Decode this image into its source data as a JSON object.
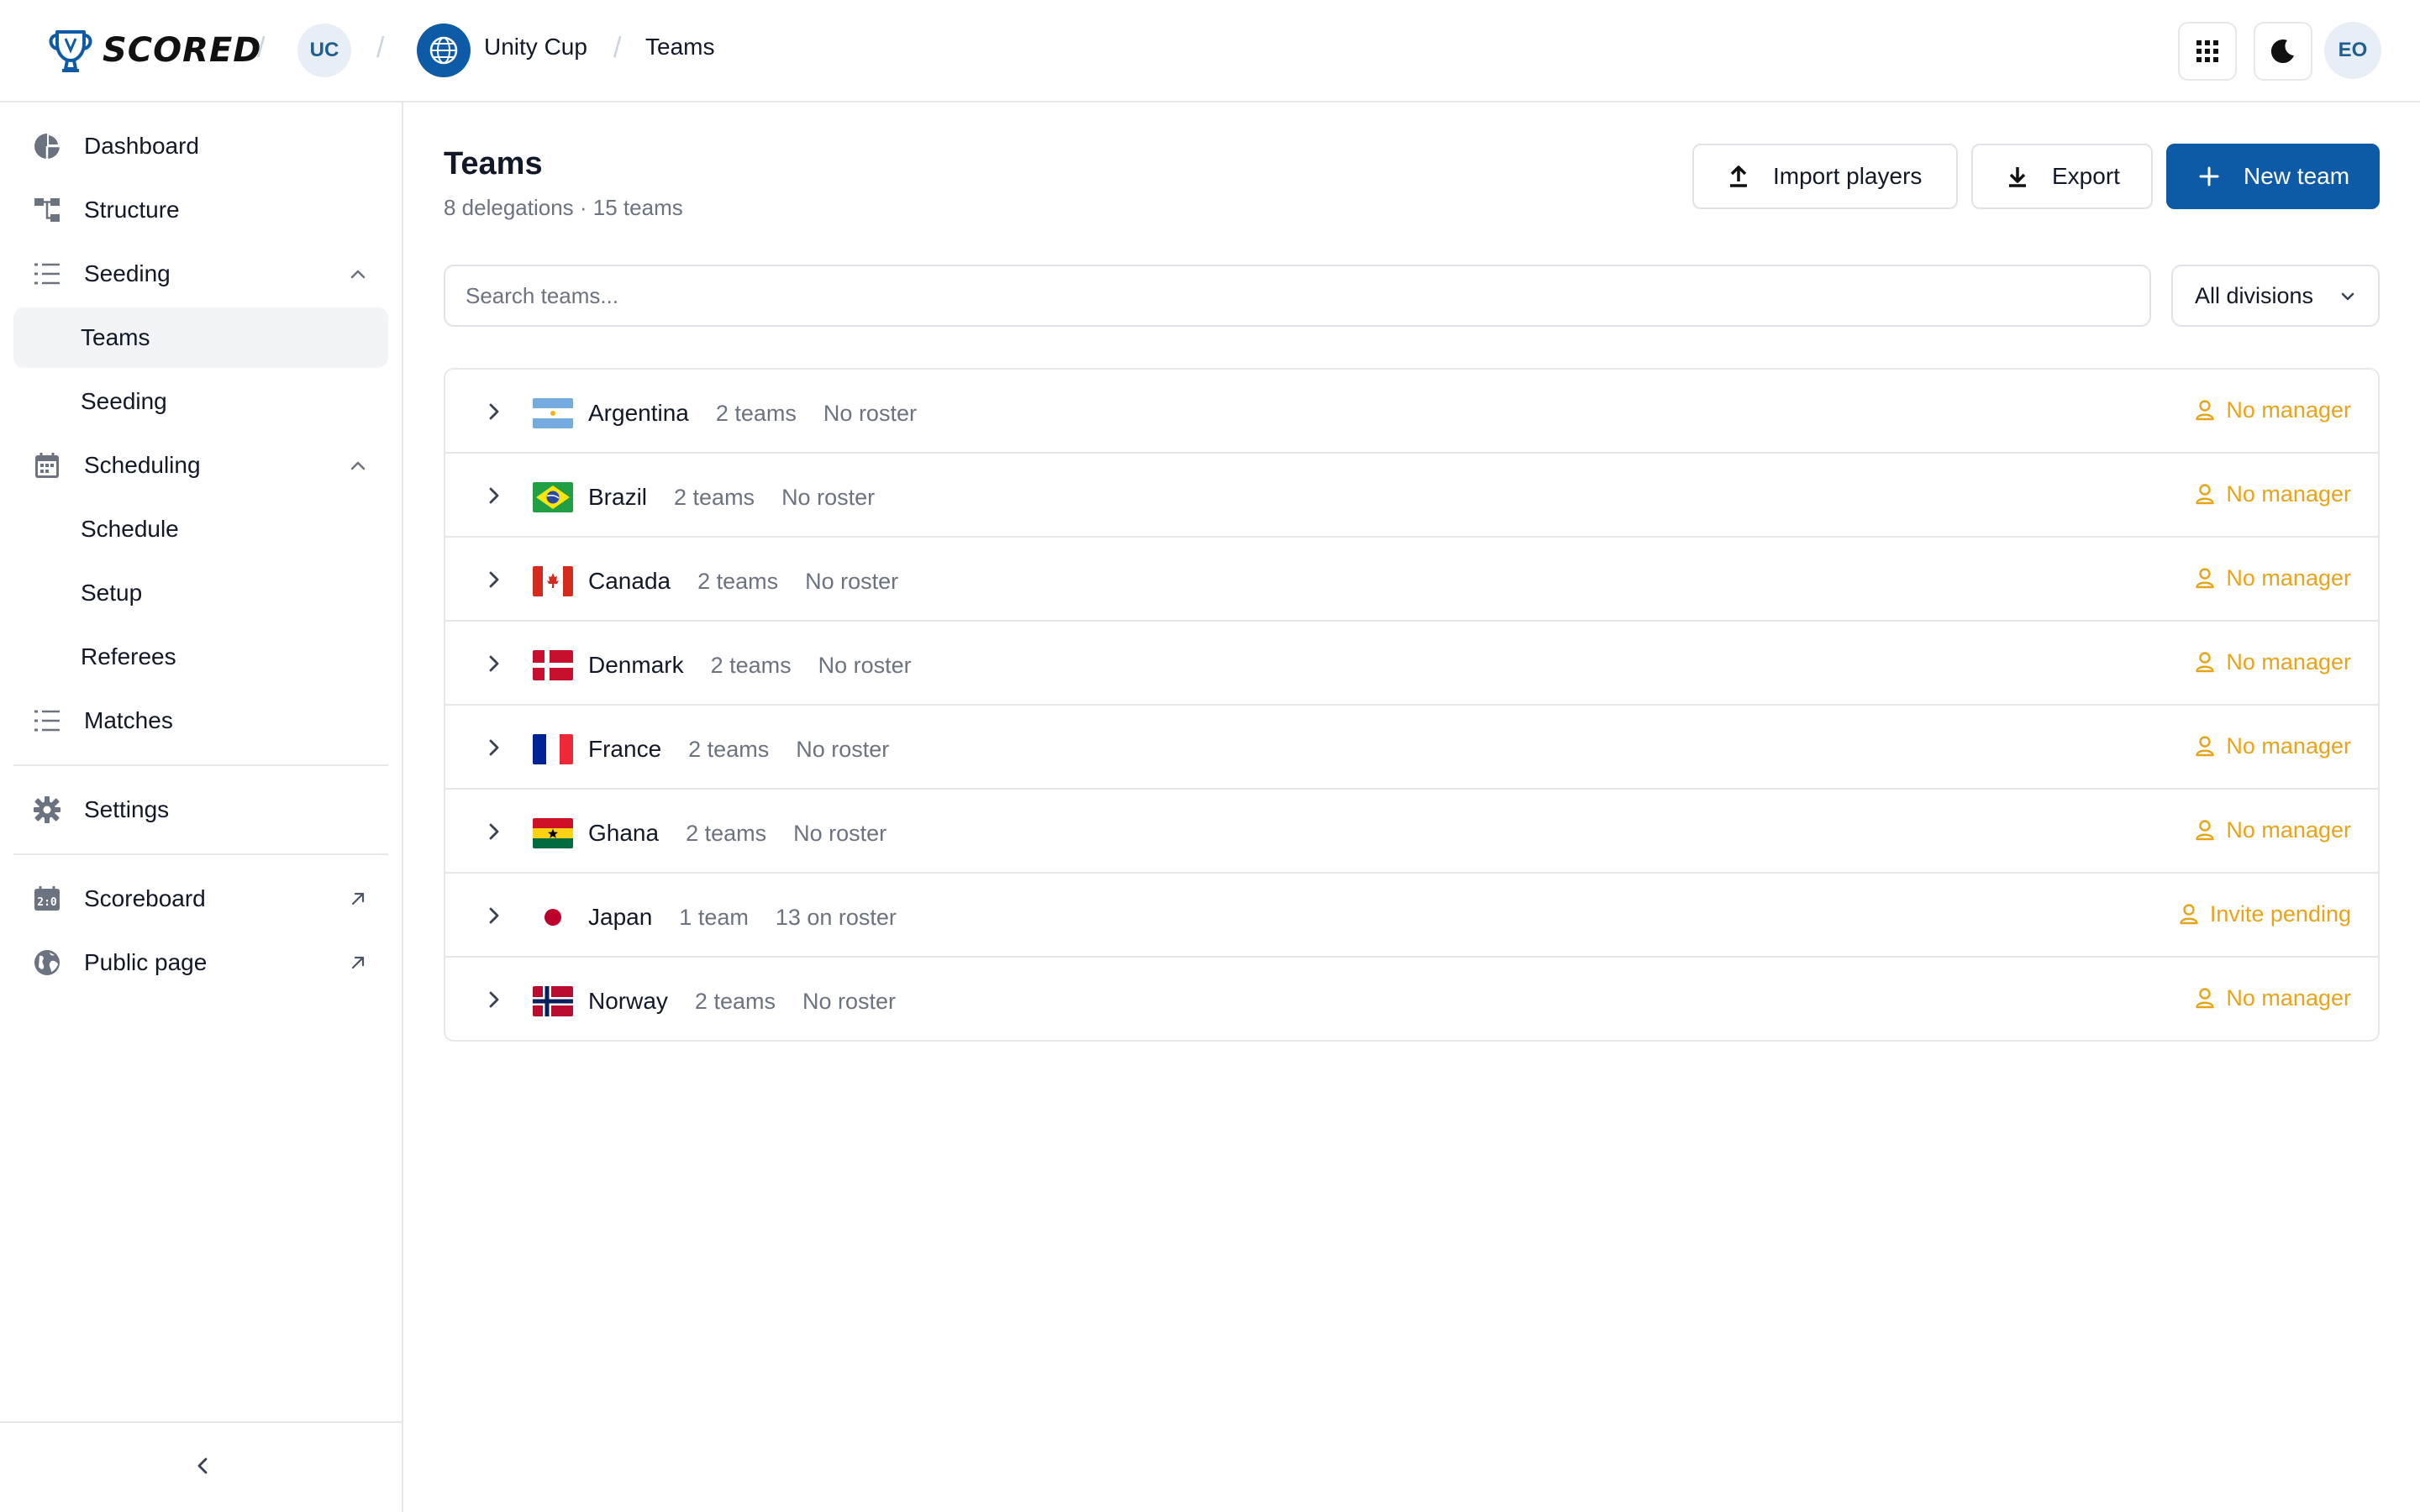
{
  "app": {
    "name": "SCORED"
  },
  "breadcrumb": {
    "org_initials": "UC",
    "event_name": "Unity Cup",
    "page": "Teams"
  },
  "header": {
    "user_initials": "EO"
  },
  "sidebar": {
    "items": [
      {
        "label": "Dashboard",
        "icon": "pie-chart-icon"
      },
      {
        "label": "Structure",
        "icon": "hierarchy-icon"
      },
      {
        "label": "Seeding",
        "icon": "list-icon",
        "expanded": true,
        "children": [
          {
            "label": "Teams",
            "active": true
          },
          {
            "label": "Seeding"
          }
        ]
      },
      {
        "label": "Scheduling",
        "icon": "calendar-icon",
        "expanded": true,
        "children": [
          {
            "label": "Schedule"
          },
          {
            "label": "Setup"
          },
          {
            "label": "Referees"
          }
        ]
      },
      {
        "label": "Matches",
        "icon": "list-icon"
      },
      {
        "label": "Settings",
        "icon": "gear-icon"
      },
      {
        "label": "Scoreboard",
        "icon": "scoreboard-icon",
        "external": true
      },
      {
        "label": "Public page",
        "icon": "globe-icon",
        "external": true
      }
    ]
  },
  "main": {
    "title": "Teams",
    "subtitle": "8 delegations · 15 teams",
    "buttons": {
      "import": "Import players",
      "export": "Export",
      "new_team": "New team"
    },
    "search": {
      "placeholder": "Search teams...",
      "value": ""
    },
    "division_filter": {
      "selected": "All divisions"
    },
    "teams": [
      {
        "name": "Argentina",
        "count": "2 teams",
        "roster": "No roster",
        "manager": "No manager"
      },
      {
        "name": "Brazil",
        "count": "2 teams",
        "roster": "No roster",
        "manager": "No manager"
      },
      {
        "name": "Canada",
        "count": "2 teams",
        "roster": "No roster",
        "manager": "No manager"
      },
      {
        "name": "Denmark",
        "count": "2 teams",
        "roster": "No roster",
        "manager": "No manager"
      },
      {
        "name": "France",
        "count": "2 teams",
        "roster": "No roster",
        "manager": "No manager"
      },
      {
        "name": "Ghana",
        "count": "2 teams",
        "roster": "No roster",
        "manager": "No manager"
      },
      {
        "name": "Japan",
        "count": "1 team",
        "roster": "13 on roster",
        "manager": "Invite pending"
      },
      {
        "name": "Norway",
        "count": "2 teams",
        "roster": "No roster",
        "manager": "No manager"
      }
    ]
  },
  "colors": {
    "primary": "#0d5aa7",
    "warning": "#e9a31b",
    "muted": "#6b7280",
    "border": "#e5e7eb"
  }
}
